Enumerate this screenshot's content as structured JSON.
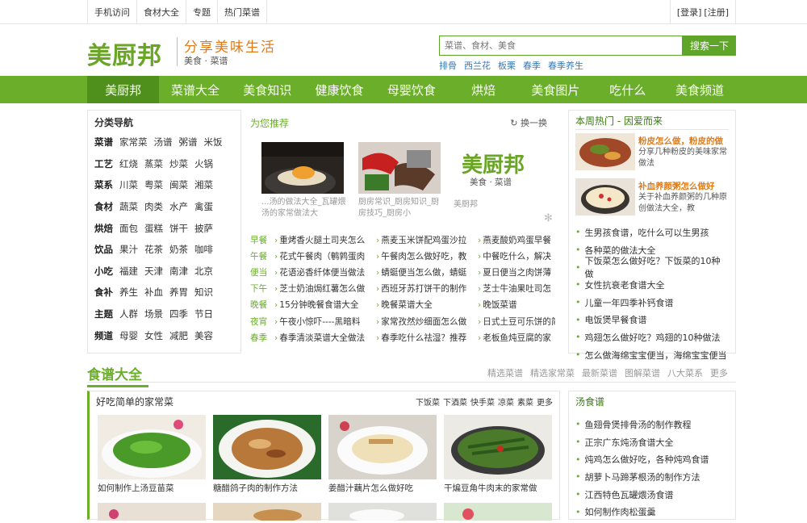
{
  "topbar": {
    "links": [
      "手机访问",
      "食材大全",
      "专题",
      "热门菜谱"
    ],
    "login": "[登录]",
    "register": "[注册]"
  },
  "header": {
    "logo": "美厨邦",
    "slogan": "分享美味生活",
    "slogan_sub": "美食 · 菜谱",
    "search_placeholder": "菜谱、食材、美食",
    "search_button": "搜索一下",
    "hotwords": [
      "排骨",
      "西兰花",
      "板栗",
      "春季",
      "春季养生"
    ]
  },
  "nav": [
    "美厨邦",
    "菜谱大全",
    "美食知识",
    "健康饮食",
    "母婴饮食",
    "烘焙",
    "美食图片",
    "吃什么",
    "美食频道"
  ],
  "categories": {
    "title": "分类导航",
    "rows": [
      {
        "head": "菜谱",
        "items": [
          "家常菜",
          "汤谱",
          "粥谱",
          "米饭"
        ]
      },
      {
        "head": "工艺",
        "items": [
          "红烧",
          "蒸菜",
          "炒菜",
          "火锅"
        ]
      },
      {
        "head": "菜系",
        "items": [
          "川菜",
          "粤菜",
          "闽菜",
          "湘菜"
        ]
      },
      {
        "head": "食材",
        "items": [
          "蔬菜",
          "肉类",
          "水产",
          "禽蛋"
        ]
      },
      {
        "head": "烘焙",
        "items": [
          "面包",
          "蛋糕",
          "饼干",
          "披萨"
        ]
      },
      {
        "head": "饮品",
        "items": [
          "果汁",
          "花茶",
          "奶茶",
          "咖啡"
        ]
      },
      {
        "head": "小吃",
        "items": [
          "福建",
          "天津",
          "南津",
          "北京"
        ]
      },
      {
        "head": "食补",
        "items": [
          "养生",
          "补血",
          "养胃",
          "知识"
        ]
      },
      {
        "head": "主题",
        "items": [
          "人群",
          "场景",
          "四季",
          "节日"
        ]
      },
      {
        "head": "频道",
        "items": [
          "母婴",
          "女性",
          "减肥",
          "美容"
        ]
      }
    ]
  },
  "recommend": {
    "title": "为您推荐",
    "refresh": "换一换",
    "captions": [
      "...汤的做法大全_瓦罐煨汤的家常做法大",
      "厨房常识_厨房知识_厨房技巧_厨房小"
    ],
    "logo": "美厨邦",
    "logo_sub": "美食 · 菜谱",
    "logo_caption": "美厨邦",
    "meals": [
      {
        "tag": "早餐",
        "items": [
          "重烤香火腿土司夹怎么",
          "燕麦玉米饼配鸡蛋沙拉",
          "燕麦酸奶鸡蛋早餐"
        ]
      },
      {
        "tag": "午餐",
        "items": [
          "花式午餐肉（鹌鹑蛋肉",
          "午餐肉怎么做好吃，教",
          "中餐吃什么，解决"
        ]
      },
      {
        "tag": "便当",
        "items": [
          "花语泌香纤体便当做法",
          "蜻蜓便当怎么做，蜻蜓",
          "夏日便当之肉饼薄"
        ]
      },
      {
        "tag": "下午",
        "items": [
          "芝士奶油焗红薯怎么做",
          "西班牙苏打饼干的制作",
          "芝士牛油果吐司怎"
        ]
      },
      {
        "tag": "晚餐",
        "items": [
          "15分钟晚餐食谱大全",
          "晚餐菜谱大全",
          "晚饭菜谱"
        ]
      },
      {
        "tag": "夜宵",
        "items": [
          "午夜小惊吓----黑暗料",
          "家常孜然炒细面怎么做",
          "日式土豆可乐饼的简"
        ]
      },
      {
        "tag": "春季",
        "items": [
          "春季清淡菜谱大全做法",
          "春季吃什么祛湿？推荐",
          "老板鱼炖豆腐的家"
        ]
      }
    ]
  },
  "hot": {
    "title": "本周热门 - 因爱而来",
    "featured": [
      {
        "title": "粉皮怎么做，粉皮的做",
        "desc": "分享几种粉皮的美味家常做法"
      },
      {
        "title": "补血养颜粥怎么做好",
        "desc": "关于补血养颜粥的几种原创做法大全，教"
      }
    ],
    "list": [
      "生男孩食谱，吃什么可以生男孩",
      "各种菜的做法大全",
      "下饭菜怎么做好吃？下饭菜的10种做",
      "女性抗衰老食谱大全",
      "儿童一年四季补钙食谱",
      "电饭煲早餐食谱",
      "鸡翅怎么做好吃？鸡翅的10种做法",
      "怎么做海绵宝宝便当，海绵宝宝便当"
    ]
  },
  "section2": {
    "title": "食谱大全",
    "links": [
      "精选菜谱",
      "精选家常菜",
      "最新菜谱",
      "图解菜谱",
      "八大菜系",
      "更多"
    ]
  },
  "family": {
    "title": "好吃简单的家常菜",
    "tags": [
      "下饭菜",
      "下酒菜",
      "快手菜",
      "凉菜",
      "素菜",
      "更多"
    ],
    "items": [
      "如何制作上汤豆苗菜",
      "糖醋鸽子肉的制作方法",
      "姜醋汁藕片怎么做好吃",
      "干煸豆角牛肉末的家常做"
    ]
  },
  "soup": {
    "title": "汤食谱",
    "list": [
      "鱼翅骨煲排骨汤的制作教程",
      "正宗广东炖汤食谱大全",
      "炖鸡怎么做好吃，各种炖鸡食谱",
      "胡萝卜马蹄茅根汤的制作方法",
      "江西特色瓦罐煨汤食谱",
      "如何制作肉松蛋羹"
    ]
  },
  "colors": {
    "brand": "#6aae29",
    "accent": "#e07b1a",
    "link": "#3a7ab8"
  }
}
